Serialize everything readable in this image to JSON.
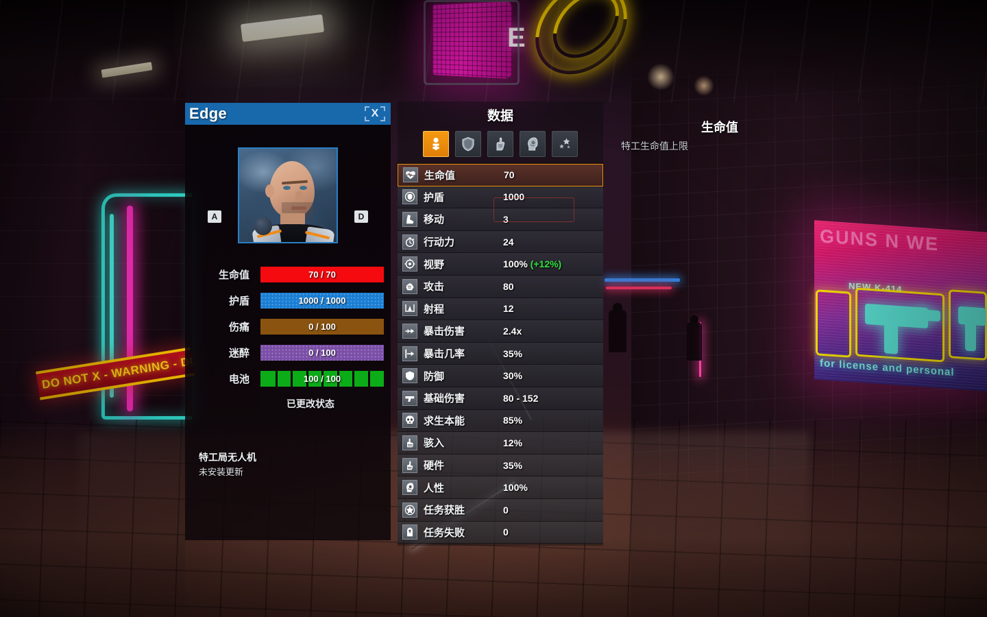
{
  "character": {
    "name": "Edge",
    "close_label": "X",
    "nav_prev_key": "A",
    "nav_next_key": "D",
    "status_changed": "已更改状态",
    "drone_title": "特工局无人机",
    "drone_sub": "未安装更新",
    "bars": [
      {
        "label": "生命值",
        "value": "70 / 70",
        "color": "#f50a10",
        "dots": false,
        "segmented": false
      },
      {
        "label": "护盾",
        "value": "1000 / 1000",
        "color": "#1b7fd4",
        "dots": true,
        "segmented": false
      },
      {
        "label": "伤痛",
        "value": "0 / 100",
        "color": "#8a5410",
        "dots": false,
        "segmented": false
      },
      {
        "label": "迷醉",
        "value": "0 / 100",
        "color": "#7b4fa8",
        "dots": true,
        "segmented": false
      },
      {
        "label": "电池",
        "value": "100 / 100",
        "color": "#0cac18",
        "dots": false,
        "segmented": true
      }
    ]
  },
  "stats": {
    "title": "数据",
    "tabs": [
      {
        "name": "tab-health",
        "icon": "person-plus-icon",
        "active": true
      },
      {
        "name": "tab-defense",
        "icon": "shield-icon",
        "active": false
      },
      {
        "name": "tab-hardware",
        "icon": "cyber-hand-icon",
        "active": false
      },
      {
        "name": "tab-mind",
        "icon": "head-icon",
        "active": false
      },
      {
        "name": "tab-perks",
        "icon": "stars-icon",
        "active": false
      }
    ],
    "rows": [
      {
        "icon": "heart-pulse-icon",
        "label": "生命值",
        "value": "70",
        "bonus": "",
        "selected": true
      },
      {
        "icon": "shield-core-icon",
        "label": "护盾",
        "value": "1000",
        "bonus": "",
        "selected": false
      },
      {
        "icon": "boot-icon",
        "label": "移动",
        "value": "3",
        "bonus": "",
        "selected": false
      },
      {
        "icon": "stopwatch-icon",
        "label": "行动力",
        "value": "24",
        "bonus": "",
        "selected": false
      },
      {
        "icon": "crosshair-icon",
        "label": "视野",
        "value": "100%",
        "bonus": "(+12%)",
        "selected": false
      },
      {
        "icon": "fist-icon",
        "label": "攻击",
        "value": "80",
        "bonus": "",
        "selected": false
      },
      {
        "icon": "range-icon",
        "label": "射程",
        "value": "12",
        "bonus": "",
        "selected": false
      },
      {
        "icon": "crit-dmg-icon",
        "label": "暴击伤害",
        "value": "2.4x",
        "bonus": "",
        "selected": false
      },
      {
        "icon": "crit-rate-icon",
        "label": "暴击几率",
        "value": "35%",
        "bonus": "",
        "selected": false
      },
      {
        "icon": "defense-icon",
        "label": "防御",
        "value": "30%",
        "bonus": "",
        "selected": false
      },
      {
        "icon": "pistol-icon",
        "label": "基础伤害",
        "value": "80 - 152",
        "bonus": "",
        "selected": false
      },
      {
        "icon": "skull-icon",
        "label": "求生本能",
        "value": "85%",
        "bonus": "",
        "selected": false
      },
      {
        "icon": "hack-hand-icon",
        "label": "骇入",
        "value": "12%",
        "bonus": "",
        "selected": false
      },
      {
        "icon": "cyber-arm-icon",
        "label": "硬件",
        "value": "35%",
        "bonus": "",
        "selected": false
      },
      {
        "icon": "brain-head-icon",
        "label": "人性",
        "value": "100%",
        "bonus": "",
        "selected": false
      },
      {
        "icon": "star-badge-icon",
        "label": "任务获胜",
        "value": "0",
        "bonus": "",
        "selected": false
      },
      {
        "icon": "grave-icon",
        "label": "任务失败",
        "value": "0",
        "bonus": "",
        "selected": false
      }
    ]
  },
  "tooltip": {
    "title": "生命值",
    "description": "特工生命值上限"
  },
  "scene": {
    "warning_sign": "DO NOT X - WARNING - DO N",
    "billboard_title": "GUNS N WE",
    "billboard_sub": "NEW K-414",
    "billboard_footer": "for license and personal",
    "led_letter": "E"
  },
  "colors": {
    "header_blue": "#1868ac",
    "accent_orange": "#e8920f",
    "health_red": "#f50a10",
    "shield_blue": "#1b7fd4",
    "pain_brown": "#8a5410",
    "intox_purple": "#7b4fa8",
    "battery_green": "#0cac18",
    "bonus_green": "#2ee03c"
  }
}
